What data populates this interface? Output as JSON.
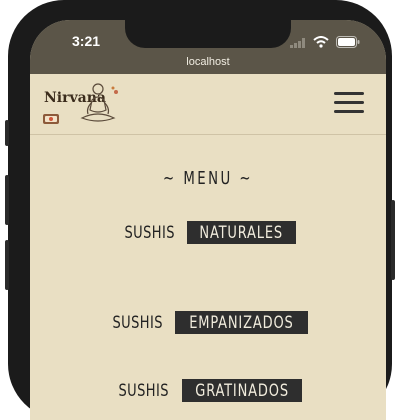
{
  "status_bar": {
    "time": "3:21",
    "url": "localhost"
  },
  "header": {
    "logo_text": "Nirvana",
    "menu_icon": "hamburger-menu-icon"
  },
  "menu": {
    "title": "~ MENU ~",
    "items": [
      {
        "prefix": "SUSHIS",
        "tag": "NATURALES"
      },
      {
        "prefix": "SUSHIS",
        "tag": "EMPANIZADOS"
      },
      {
        "prefix": "SUSHIS",
        "tag": "GRATINADOS"
      }
    ]
  },
  "colors": {
    "page_background": "#e9dfc3",
    "status_bar": "#5b5548",
    "tag_background": "#2e2e2e",
    "text": "#222222"
  }
}
